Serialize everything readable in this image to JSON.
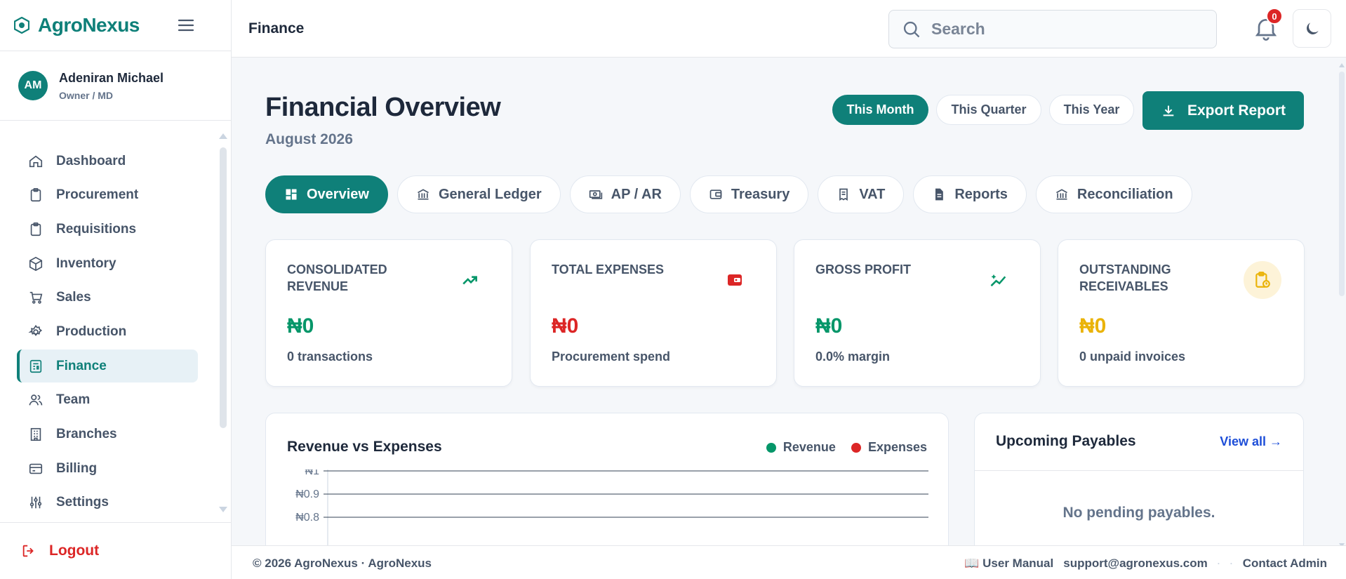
{
  "brand": {
    "name": "AgroNexus"
  },
  "user": {
    "initials": "AM",
    "name": "Adeniran Michael",
    "role": "Owner / MD"
  },
  "sidebar": {
    "items": [
      {
        "label": "Dashboard",
        "icon": "home-icon"
      },
      {
        "label": "Procurement",
        "icon": "clipboard-icon"
      },
      {
        "label": "Requisitions",
        "icon": "clipboard-icon"
      },
      {
        "label": "Inventory",
        "icon": "box-icon"
      },
      {
        "label": "Sales",
        "icon": "cart-icon"
      },
      {
        "label": "Production",
        "icon": "gear-icon"
      },
      {
        "label": "Finance",
        "icon": "finance-icon",
        "active": true
      },
      {
        "label": "Team",
        "icon": "team-icon"
      },
      {
        "label": "Branches",
        "icon": "building-icon"
      },
      {
        "label": "Billing",
        "icon": "card-icon"
      },
      {
        "label": "Settings",
        "icon": "sliders-icon"
      }
    ],
    "logout": "Logout"
  },
  "topbar": {
    "page_name": "Finance",
    "search_placeholder": "Search",
    "notification_count": "0"
  },
  "overview": {
    "title": "Financial Overview",
    "period_label": "August 2026",
    "periods": [
      "This Month",
      "This Quarter",
      "This Year"
    ],
    "active_period": "This Month",
    "export_label": "Export Report"
  },
  "tabs": [
    {
      "label": "Overview",
      "icon": "grid-icon",
      "active": true
    },
    {
      "label": "General Ledger",
      "icon": "bank-icon"
    },
    {
      "label": "AP / AR",
      "icon": "money-icon"
    },
    {
      "label": "Treasury",
      "icon": "wallet-icon"
    },
    {
      "label": "VAT",
      "icon": "receipt-icon"
    },
    {
      "label": "Reports",
      "icon": "document-icon"
    },
    {
      "label": "Reconciliation",
      "icon": "bank-icon"
    }
  ],
  "cards": [
    {
      "label": "CONSOLIDATED REVENUE",
      "value": "₦0",
      "sub": "0 transactions",
      "color": "#059669",
      "icon": "trend-up-icon"
    },
    {
      "label": "TOTAL EXPENSES",
      "value": "₦0",
      "sub": "Procurement spend",
      "color": "#dc2626",
      "icon": "wallet-icon"
    },
    {
      "label": "GROSS PROFIT",
      "value": "₦0",
      "sub": "0.0% margin",
      "color": "#059669",
      "icon": "chart-sparkle-icon"
    },
    {
      "label": "OUTSTANDING RECEIVABLES",
      "value": "₦0",
      "sub": "0 unpaid invoices",
      "color": "#eab308",
      "icon": "clipboard-clock-icon"
    }
  ],
  "chart_data": {
    "type": "line",
    "title": "Revenue vs Expenses",
    "series": [
      {
        "name": "Revenue",
        "color": "#059669",
        "values": []
      },
      {
        "name": "Expenses",
        "color": "#dc2626",
        "values": []
      }
    ],
    "y_ticks": [
      "₦1",
      "₦0.9",
      "₦0.8"
    ],
    "ylim": [
      0,
      1
    ],
    "grid": true,
    "legend": "top-right"
  },
  "payables": {
    "title": "Upcoming Payables",
    "view_all": "View all →",
    "empty": "No pending payables."
  },
  "footer": {
    "copyright": "© 2026 AgroNexus · AgroNexus",
    "manual": "📖 User Manual",
    "email": "support@agronexus.com",
    "contact": "Contact Admin"
  },
  "colors": {
    "brand": "#0f8079",
    "danger": "#dc2626",
    "success": "#059669",
    "warning": "#eab308"
  }
}
